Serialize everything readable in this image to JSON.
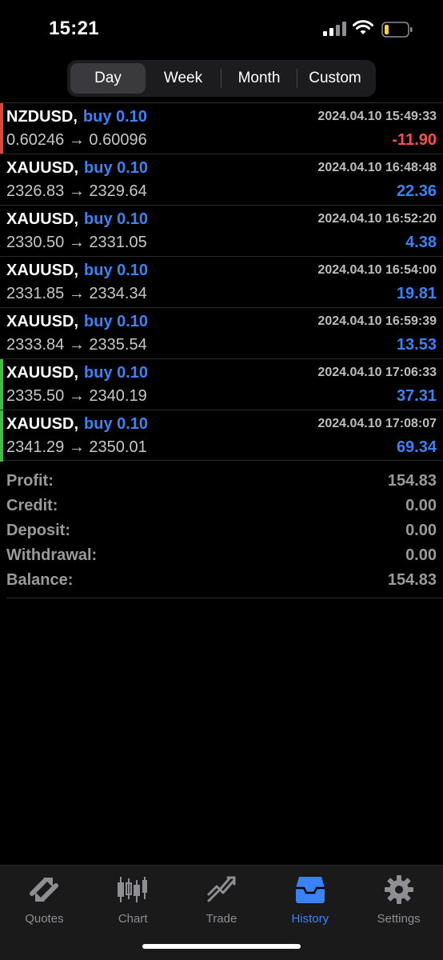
{
  "status_bar": {
    "time": "15:21"
  },
  "segments": [
    {
      "label": "Day",
      "active": true
    },
    {
      "label": "Week",
      "active": false
    },
    {
      "label": "Month",
      "active": false
    },
    {
      "label": "Custom",
      "active": false
    }
  ],
  "colors": {
    "accent_blue": "#3b82f6",
    "loss_red": "#ff4d4d",
    "accent_red_bar": "#e0453a",
    "accent_green_bar": "#3fbf3f"
  },
  "trades": [
    {
      "symbol": "NZDUSD,",
      "side": "buy 0.10",
      "time": "2024.04.10 15:49:33",
      "prices": "0.60246 → 0.60096",
      "profit": "-11.90",
      "profit_color": "#ff4d4d",
      "accent": "#e0453a"
    },
    {
      "symbol": "XAUUSD,",
      "side": "buy 0.10",
      "time": "2024.04.10 16:48:48",
      "prices": "2326.83 → 2329.64",
      "profit": "22.36",
      "profit_color": "#3b82f6",
      "accent": ""
    },
    {
      "symbol": "XAUUSD,",
      "side": "buy 0.10",
      "time": "2024.04.10 16:52:20",
      "prices": "2330.50 → 2331.05",
      "profit": "4.38",
      "profit_color": "#3b82f6",
      "accent": ""
    },
    {
      "symbol": "XAUUSD,",
      "side": "buy 0.10",
      "time": "2024.04.10 16:54:00",
      "prices": "2331.85 → 2334.34",
      "profit": "19.81",
      "profit_color": "#3b82f6",
      "accent": ""
    },
    {
      "symbol": "XAUUSD,",
      "side": "buy 0.10",
      "time": "2024.04.10 16:59:39",
      "prices": "2333.84 → 2335.54",
      "profit": "13.53",
      "profit_color": "#3b82f6",
      "accent": ""
    },
    {
      "symbol": "XAUUSD,",
      "side": "buy 0.10",
      "time": "2024.04.10 17:06:33",
      "prices": "2335.50 → 2340.19",
      "profit": "37.31",
      "profit_color": "#3b82f6",
      "accent": "#3fbf3f"
    },
    {
      "symbol": "XAUUSD,",
      "side": "buy 0.10",
      "time": "2024.04.10 17:08:07",
      "prices": "2341.29 → 2350.01",
      "profit": "69.34",
      "profit_color": "#3b82f6",
      "accent": "#3fbf3f"
    }
  ],
  "summary": [
    {
      "label": "Profit:",
      "value": "154.83"
    },
    {
      "label": "Credit:",
      "value": "0.00"
    },
    {
      "label": "Deposit:",
      "value": "0.00"
    },
    {
      "label": "Withdrawal:",
      "value": "0.00"
    },
    {
      "label": "Balance:",
      "value": "154.83"
    }
  ],
  "tabs": [
    {
      "label": "Quotes",
      "icon": "quotes-icon",
      "active": false
    },
    {
      "label": "Chart",
      "icon": "chart-icon",
      "active": false
    },
    {
      "label": "Trade",
      "icon": "trade-icon",
      "active": false
    },
    {
      "label": "History",
      "icon": "history-icon",
      "active": true
    },
    {
      "label": "Settings",
      "icon": "gear-icon",
      "active": false
    }
  ]
}
